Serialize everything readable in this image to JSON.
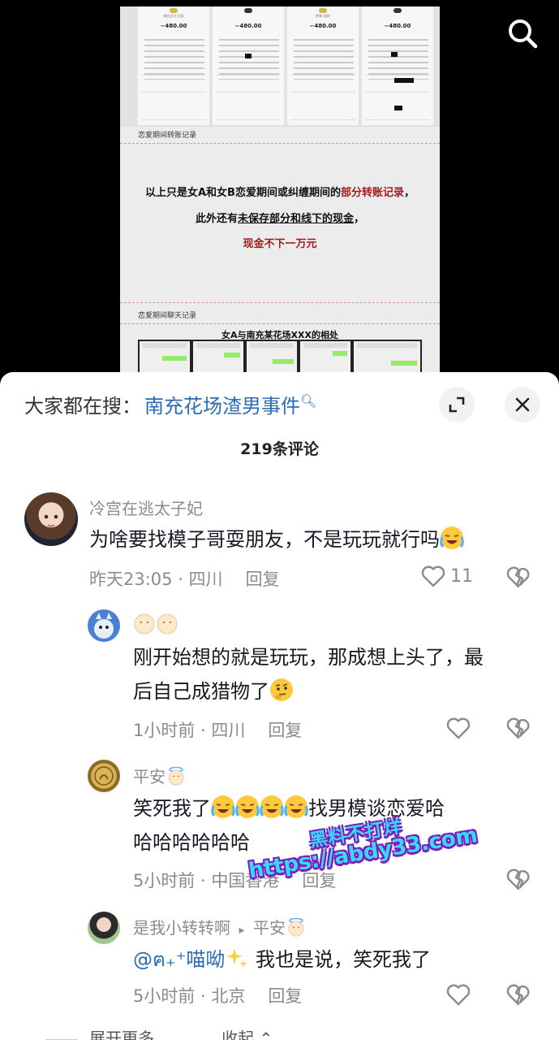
{
  "media": {
    "receipts": [
      {
        "caption": "微信支付-扫码",
        "amount": "−480.00"
      },
      {
        "caption": "",
        "amount": "−480.00"
      },
      {
        "caption": "转账-退款",
        "amount": "−480.00"
      },
      {
        "caption": "",
        "amount": "−480.00"
      }
    ],
    "section_transfer": "恋爱期间转账记录",
    "line1_a": "以上只是女A和女B恋爱期间或纠缠期间的",
    "line1_b": "部分转账记录",
    "line1_c": "，",
    "line2_a": "此外还有",
    "line2_b": "未保存部分和线下的现金",
    "line2_c": "，",
    "line3": "现金不下一万元",
    "section_chat": "恋爱期间聊天记录",
    "chat_title": "女A与南充某花场XXX的相处"
  },
  "sheet": {
    "search_prefix": "大家都在搜：",
    "search_link": "南充花场渣男事件",
    "comment_count": "219条评论"
  },
  "comments": [
    {
      "user": "冷宫在逃太子妃",
      "text": "为啥要找模子哥耍朋友，不是玩玩就行吗",
      "time": "昨天23:05 · 四川",
      "reply": "回复",
      "likes": "11"
    },
    {
      "user": "",
      "text_l1": "刚开始想的就是玩玩，那成想上头了，最",
      "text_l2": "后自己成猎物了",
      "time": "1小时前 · 四川",
      "reply": "回复"
    },
    {
      "user": "平安",
      "text_l1a": "笑死我了",
      "text_l1b": "找男模谈恋爱哈",
      "text_l2": "哈哈哈哈哈哈",
      "time": "5小时前 · 中国香港",
      "reply": "回复"
    },
    {
      "user": "是我小转转啊",
      "reply_to": "平安",
      "mention": "@ฅ₊⁺喵呦",
      "text": " 我也是说，笑死我了",
      "time": "5小时前 · 北京",
      "reply": "回复"
    }
  ],
  "footer": {
    "expand": "展开更多",
    "collapse": "收起"
  },
  "watermark": {
    "line1": "黑料不打烊",
    "line2": "https://abdy33.com"
  }
}
